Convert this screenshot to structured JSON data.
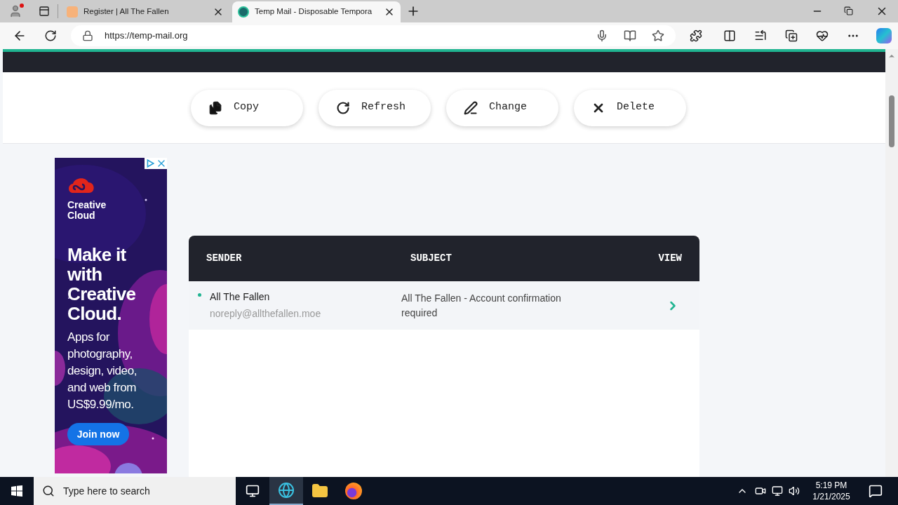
{
  "browser": {
    "tabs": [
      {
        "title": "Register | All The Fallen",
        "selected": false
      },
      {
        "title": "Temp Mail - Disposable Tempora",
        "selected": true
      }
    ],
    "address": "https://temp-mail.org"
  },
  "actions": [
    {
      "kind": "copy",
      "label": "Copy"
    },
    {
      "kind": "refresh",
      "label": "Refresh"
    },
    {
      "kind": "change",
      "label": "Change"
    },
    {
      "kind": "delete",
      "label": "Delete"
    }
  ],
  "ad": {
    "brand": "Creative Cloud",
    "headline": "Make it with Creative Cloud.",
    "body": "Apps for photography, design, video, and web from US$9.99/mo.",
    "button": "Join now"
  },
  "inbox": {
    "columns": [
      "SENDER",
      "SUBJECT",
      "VIEW"
    ],
    "rows": [
      {
        "sender": "All The Fallen",
        "email": "noreply@allthefallen.moe",
        "subject": "All The Fallen - Account confirmation required",
        "unread": true
      }
    ]
  },
  "taskbar": {
    "search_placeholder": "Type here to search",
    "time": "5:19 PM",
    "date": "1/21/2025"
  }
}
